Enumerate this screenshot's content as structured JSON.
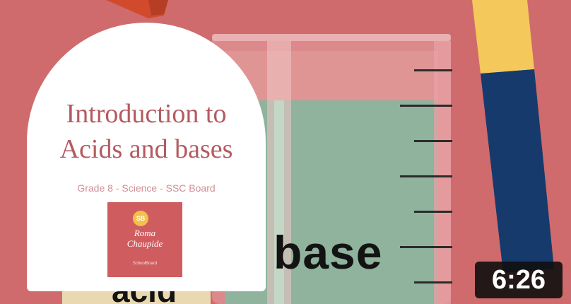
{
  "card": {
    "title_line1": "Introduction to",
    "title_line2": "Acids and bases",
    "subtitle": "Grade 8 - Science - SSC Board"
  },
  "logo": {
    "badge": "SB",
    "name": "Roma\nChaupide",
    "tag": "SchoolBoard"
  },
  "scene": {
    "word_base": "base",
    "word_acid": "acid"
  },
  "duration": "6:26",
  "colors": {
    "background": "#cf6b6c",
    "beaker_liquid": "#8fb39d",
    "pencil_yellow": "#f5c85c",
    "pencil_blue": "#163a6b",
    "title_color": "#b45a61"
  }
}
